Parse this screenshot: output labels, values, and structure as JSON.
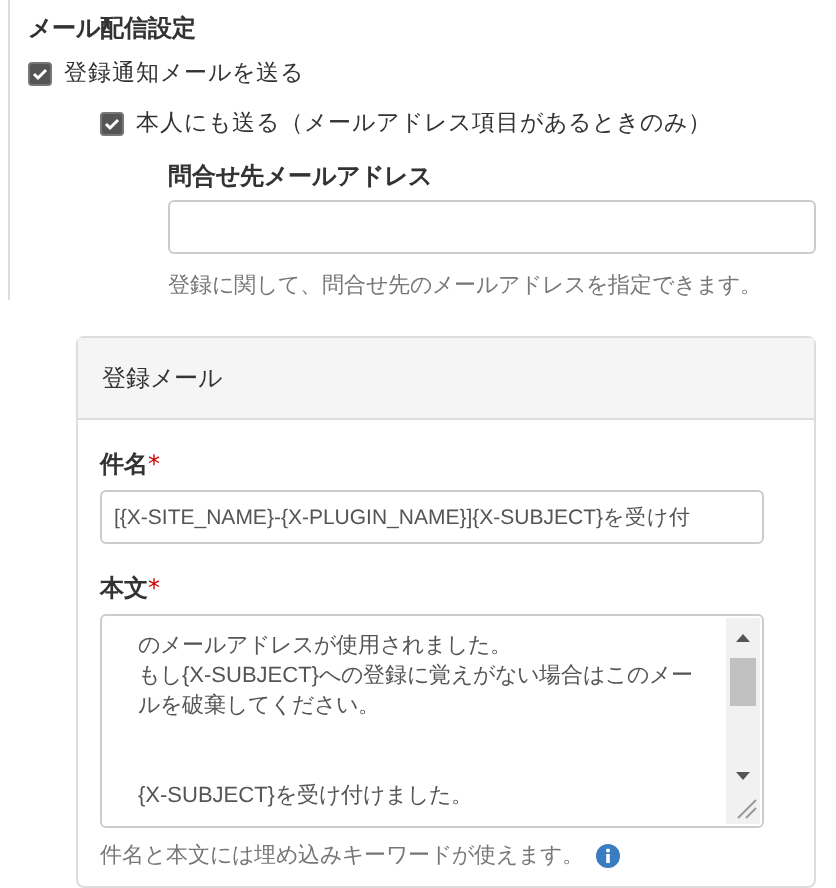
{
  "section_title": "メール配信設定",
  "checkboxes": [
    {
      "label": "登録通知メールを送る",
      "checked": true
    },
    {
      "label": "本人にも送る（メールアドレス項目があるときのみ）",
      "checked": true
    }
  ],
  "contact_field": {
    "label": "問合せ先メールアドレス",
    "help": "登録に関して、問合せ先のメールアドレスを指定できます。"
  },
  "panel": {
    "title": "登録メール",
    "subject": {
      "label": "件名",
      "required": "*",
      "value": "[{X-SITE_NAME}-{X-PLUGIN_NAME}]{X-SUBJECT}を受け付"
    },
    "body": {
      "label": "本文",
      "required": "*",
      "paragraphs": [
        [
          "のメールアドレスが使用されました。",
          "もし{X-SUBJECT}への登録に覚えがない場合はこのメー",
          "ルを破棄してください。"
        ],
        [
          "{X-SUBJECT}を受け付けました。"
        ]
      ]
    },
    "help": "件名と本文には埋め込みキーワードが使えます。"
  }
}
